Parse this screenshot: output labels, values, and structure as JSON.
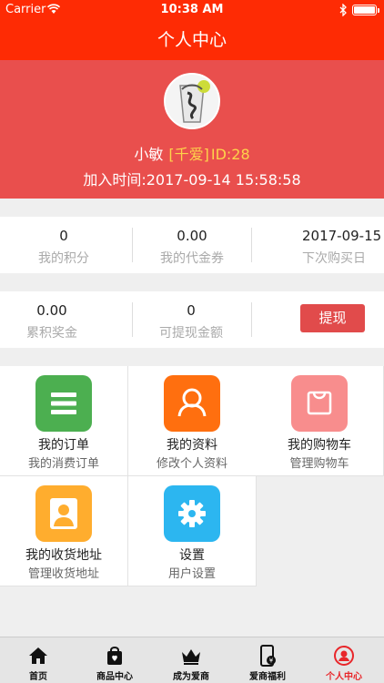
{
  "status_bar": {
    "carrier": "Carrier",
    "time": "10:38 AM"
  },
  "nav": {
    "title": "个人中心"
  },
  "profile": {
    "name": "小敏",
    "level": "[千爱]",
    "id_text": "ID:28",
    "join_time": "加入时间:2017-09-14 15:58:58"
  },
  "stats": [
    {
      "value": "0",
      "label": "我的积分"
    },
    {
      "value": "0.00",
      "label": "我的代金券"
    },
    {
      "value": "2017-09-15",
      "label": "下次购买日"
    }
  ],
  "money": [
    {
      "value": "0.00",
      "label": "累积奖金"
    },
    {
      "value": "0",
      "label": "可提现金额"
    }
  ],
  "withdraw_label": "提现",
  "menu": [
    {
      "title": "我的订单",
      "subtitle": "我的消费订单",
      "icon": "list-icon",
      "color": "#4caf50"
    },
    {
      "title": "我的资料",
      "subtitle": "修改个人资料",
      "icon": "person-icon",
      "color": "#ff6f0f"
    },
    {
      "title": "我的购物车",
      "subtitle": "管理购物车",
      "icon": "bag-icon",
      "color": "#f88d8d"
    },
    {
      "title": "我的收货地址",
      "subtitle": "管理收货地址",
      "icon": "contact-icon",
      "color": "#ffad2e"
    },
    {
      "title": "设置",
      "subtitle": "用户设置",
      "icon": "gear-icon",
      "color": "#2cb6f0"
    }
  ],
  "tabs": [
    {
      "label": "首页",
      "icon": "home-icon"
    },
    {
      "label": "商品中心",
      "icon": "shopping-bag-icon"
    },
    {
      "label": "成为爱商",
      "icon": "crown-icon"
    },
    {
      "label": "爱商福利",
      "icon": "phone-icon"
    },
    {
      "label": "个人中心",
      "icon": "user-circle-icon",
      "active": true
    }
  ],
  "colors": {
    "header": "#fe2b04",
    "profile_bg": "#e94f4d",
    "accent": "#e14b4b",
    "level": "#fdd34b"
  }
}
